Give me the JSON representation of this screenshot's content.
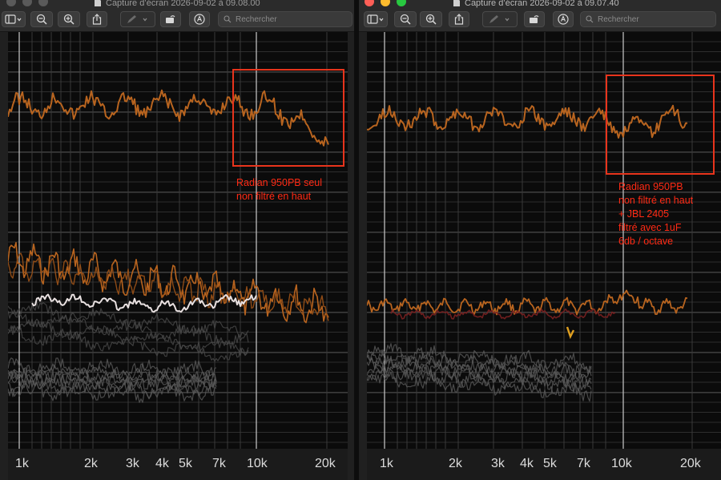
{
  "left_window": {
    "title": "Capture d’écran 2026-09-02 à 09.08.00",
    "search_placeholder": "Rechercher",
    "annotation": "Radian 950PB seul\nnon filtré en haut",
    "freq_labels": [
      "1k",
      "2k",
      "3k",
      "4k",
      "5k",
      "7k",
      "10k",
      "20k"
    ]
  },
  "right_window": {
    "title": "Capture d’écran 2026-09-02 à 09.07.40",
    "search_placeholder": "Rechercher",
    "annotation": "Radian 950PB\nnon filtré en haut\n+ JBL 2405\nfiltré avec 1uF\n6db / octave",
    "freq_labels": [
      "1k",
      "2k",
      "3k",
      "4k",
      "5k",
      "7k",
      "10k",
      "20k"
    ]
  },
  "colors": {
    "traffic_close": "#fe5f57",
    "traffic_min": "#febc2e",
    "traffic_max": "#28c840",
    "response_orange": "#b8641f",
    "annotation_red": "#e8341c",
    "grid": "#3a3a3a"
  }
}
